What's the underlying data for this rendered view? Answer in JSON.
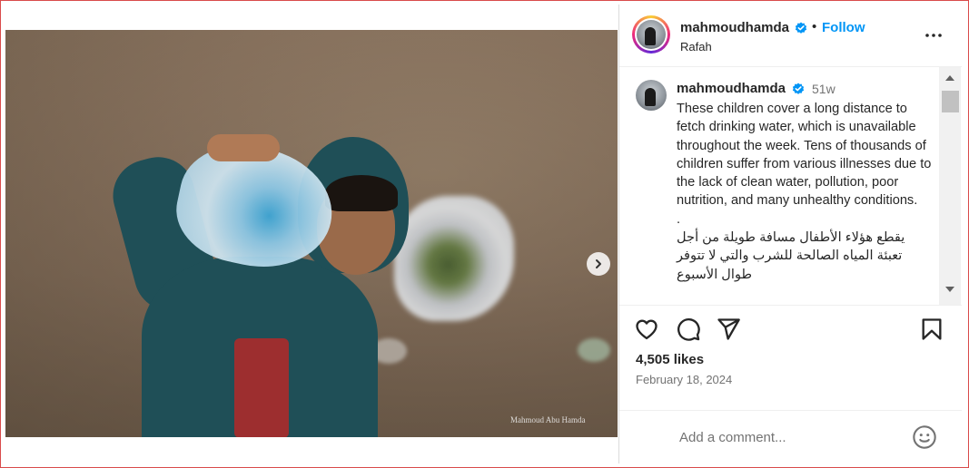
{
  "post": {
    "author": "mahmoudhamda",
    "follow_label": "Follow",
    "separator": "•",
    "location": "Rafah",
    "media": {
      "watermark_line1": "Mahmoud Abu Hamda",
      "carousel_dots": 5,
      "active_dot": 0
    },
    "caption": {
      "author": "mahmoudhamda",
      "time": "51w",
      "paragraphs": [
        "These children cover a long distance to fetch drinking water, which is unavailable throughout the week. Tens of thousands of children suffer from various illnesses due to the lack of clean water, pollution, poor nutrition, and many unhealthy conditions.",
        ".",
        "يقطع هؤلاء الأطفال مسافة طويلة من أجل تعبئة المياه الصالحة للشرب والتي لا تتوفر طوال الأسبوع"
      ]
    },
    "likes": "4,505 likes",
    "date": "February 18, 2024",
    "comment_placeholder": "Add a comment..."
  },
  "icons": {
    "verified": "verified-badge-icon",
    "more": "more-options-icon",
    "next": "chevron-right-icon",
    "like": "heart-icon",
    "comment": "comment-icon",
    "share": "send-icon",
    "save": "bookmark-icon",
    "emoji": "emoji-icon"
  },
  "colors": {
    "accent": "#0095f6",
    "text": "#262626",
    "muted": "#737373",
    "border": "#dbdbdb",
    "verified": "#0095f6"
  }
}
